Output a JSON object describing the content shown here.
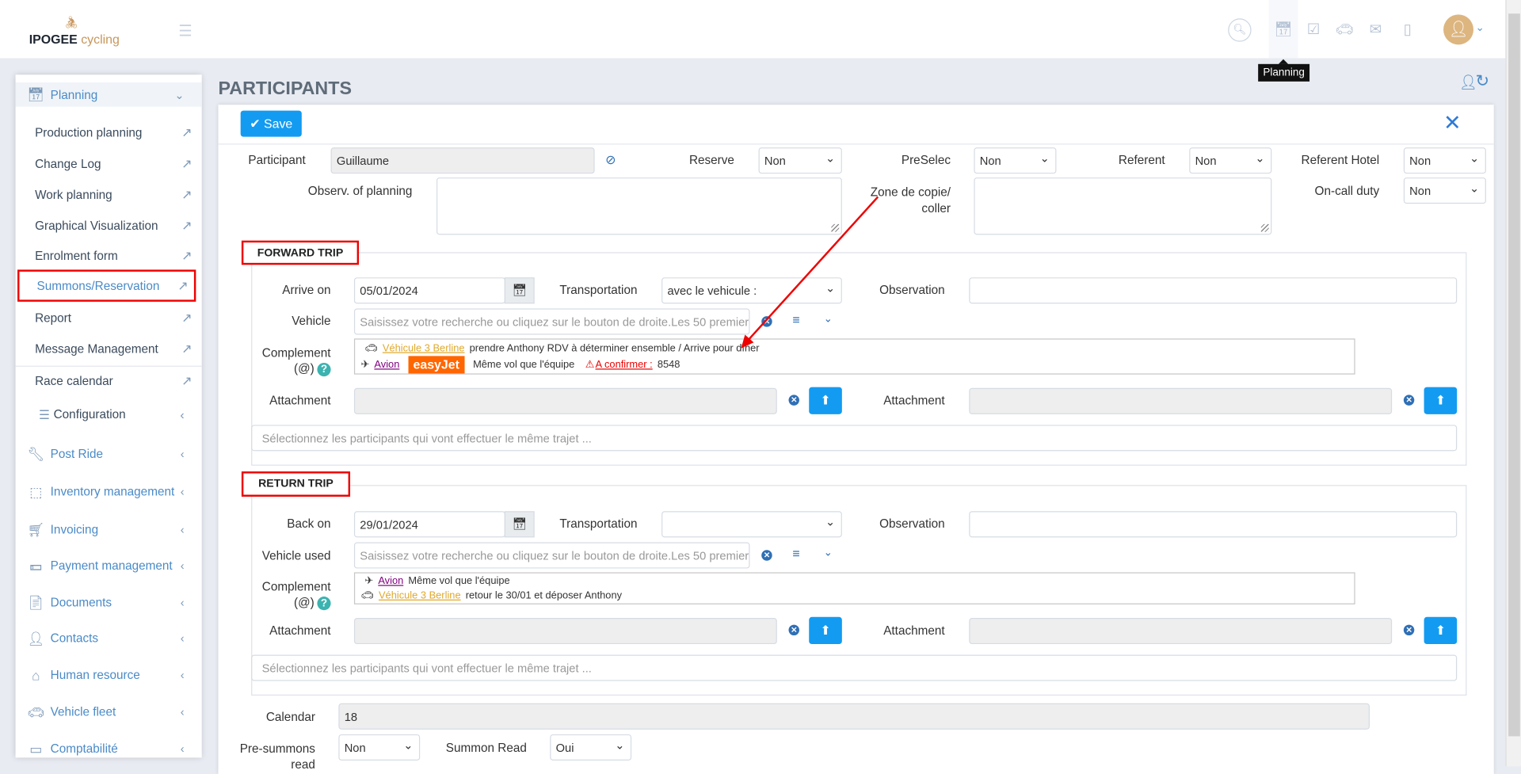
{
  "app": {
    "logo_main": "IPOGEE",
    "logo_sub": "cycling",
    "tooltip": "Planning"
  },
  "header_icons": [
    "search-icon",
    "calendar-icon",
    "calendar-check-icon",
    "car-icon",
    "envelope-open-icon",
    "notebook-icon",
    "user-avatar-icon"
  ],
  "sidebar": {
    "planning": "Planning",
    "sub": [
      "Production planning",
      "Change Log",
      "Work planning",
      "Graphical Visualization",
      "Enrolment form",
      "Summons/Reservation",
      "Report",
      "Message Management",
      "Race calendar"
    ],
    "configuration": "Configuration",
    "menus": [
      "Post Ride",
      "Inventory management",
      "Invoicing",
      "Payment management",
      "Documents",
      "Contacts",
      "Human resource",
      "Vehicle fleet",
      "Comptabilité"
    ]
  },
  "page": {
    "title": "PARTICIPANTS",
    "save": "Save"
  },
  "form": {
    "participant_label": "Participant",
    "participant_value": "Guillaume",
    "reserve_label": "Reserve",
    "reserve_value": "Non",
    "preselec_label": "PreSelec",
    "preselec_value": "Non",
    "referent_label": "Referent",
    "referent_value": "Non",
    "referent_hotel_label": "Referent Hotel",
    "referent_hotel_value": "Non",
    "observ_label": "Observ. of planning",
    "zone_label_1": "Zone de copie/",
    "zone_label_2": "coller",
    "oncall_label": "On-call duty",
    "oncall_value": "Non"
  },
  "forward": {
    "legend": "FORWARD TRIP",
    "arrive_label": "Arrive on",
    "arrive_value": "05/01/2024",
    "transport_label": "Transportation",
    "transport_value": "avec le vehicule :",
    "observation_label": "Observation",
    "vehicle_label": "Vehicle",
    "vehicle_placeholder": "Saisissez votre recherche ou cliquez sur le bouton de droite.Les 50 premiers",
    "complement_label": "Complement",
    "complement_at": "(@)",
    "line1_link": "Véhicule 3 Berline",
    "line1_text": "prendre Anthony RDV à déterminer ensemble / Arrive pour dîner",
    "line2_link": "Avion",
    "line2_brand": "easyJet",
    "line2_text": "Même vol que l'équipe",
    "line2_warn": "A confirmer :",
    "line2_num": "8548",
    "attachment_label": "Attachment",
    "attachment2_label": "Attachment",
    "participants_placeholder": "Sélectionnez les participants qui vont effectuer le même trajet ..."
  },
  "return": {
    "legend": "RETURN TRIP",
    "back_label": "Back on",
    "back_value": "29/01/2024",
    "transport_label": "Transportation",
    "transport_value": "",
    "observation_label": "Observation",
    "vehicle_label": "Vehicle used",
    "vehicle_placeholder": "Saisissez votre recherche ou cliquez sur le bouton de droite.Les 50 premiers",
    "complement_label": "Complement",
    "complement_at": "(@)",
    "line1_link": "Avion",
    "line1_text": "Même vol que l'équipe",
    "line2_link": "Véhicule 3 Berline",
    "line2_text": "retour le 30/01 et déposer Anthony",
    "attachment_label": "Attachment",
    "attachment2_label": "Attachment",
    "participants_placeholder": "Sélectionnez les participants qui vont effectuer le même trajet ..."
  },
  "footer": {
    "calendar_label": "Calendar",
    "calendar_value": "18",
    "presummons_label_1": "Pre-summons",
    "presummons_label_2": "read",
    "presummons_value": "Non",
    "summon_read_label": "Summon Read",
    "summon_read_value": "Oui"
  },
  "colors": {
    "accent": "#139bf1",
    "highlight": "#ee0000",
    "logo_accent": "#c8965a"
  }
}
